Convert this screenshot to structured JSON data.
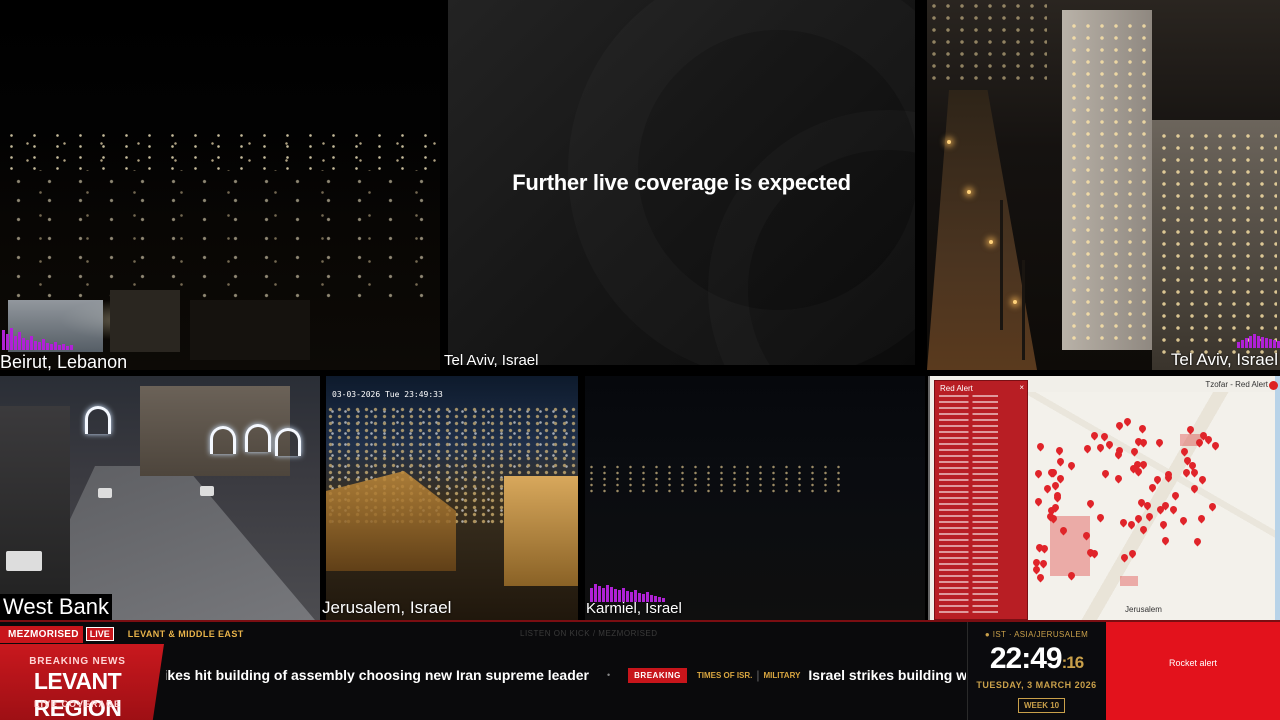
{
  "cameras": {
    "beirut": {
      "label": "Beirut, Lebanon"
    },
    "center": {
      "label": "Tel Aviv, Israel",
      "message": "Further live coverage is expected"
    },
    "telaviv_right": {
      "label": "Tel Aviv, Israel"
    },
    "westbank": {
      "label": "West Bank"
    },
    "jerusalem": {
      "label": "Jerusalem, Israel",
      "timestamp": "03-03-2026 Tue 23:49:33"
    },
    "karmiel": {
      "label": "Karmiel, Israel"
    }
  },
  "map": {
    "header": "Tzofar - Red Alert",
    "list_title": "Red Alert",
    "list_close": "×",
    "city_label": "Jerusalem"
  },
  "ticker": {
    "brand": "MEZMORISED",
    "live": "LIVE",
    "region_tag": "LEVANT & MIDDLE EAST",
    "faint_text": "LISTEN ON KICK / MEZMORISED",
    "breaking_label": "BREAKING NEWS",
    "breaking_region": "LEVANT REGION",
    "breaking_coverage": "LIVE COVERAGE",
    "headline_1": "rikes hit building of assembly choosing new Iran supreme leader",
    "separator": "•",
    "breaking_tag": "BREAKING",
    "source": "TIMES OF ISR.",
    "pipe": "|",
    "category": "MILITARY",
    "headline_2": "Israel strikes building where Iranian clerics said gathering to elect n"
  },
  "clock": {
    "timezone": "● IST · ASIA/JERUSALEM",
    "hours_minutes": "22:49",
    "seconds": ":16",
    "date": "TUESDAY, 3 MARCH 2026",
    "week": "WEEK 10"
  },
  "rocket_alert": {
    "label": "Rocket alert"
  },
  "colors": {
    "accent_red": "#c8151b",
    "gold": "#c9a04a",
    "audio_bars": "#b021d6",
    "map_pin": "#e0242a"
  }
}
